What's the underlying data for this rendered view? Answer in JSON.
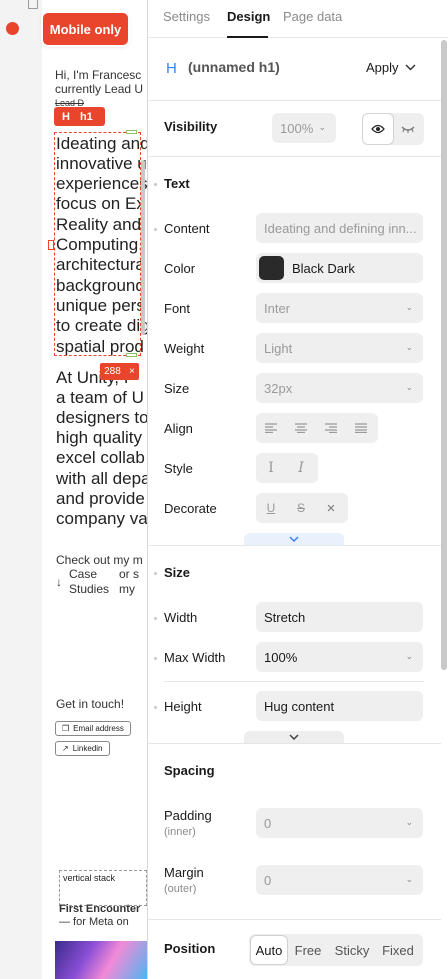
{
  "canvas": {
    "badge": "Mobile only",
    "intro_lines": [
      "Hi, I'm Francesc",
      "currently Lead U",
      "Lead D"
    ],
    "h1_tag_icon": "H",
    "h1_tag_label": "h1",
    "h1_lines": [
      "Ideating and",
      "innovative u",
      "experiences",
      "focus on Ex",
      "Reality and",
      "Computing.",
      "architectura",
      "background",
      "unique pers",
      "to create dig",
      "spatial prod"
    ],
    "size_badge_value": "288",
    "size_badge_close": "×",
    "para_lines": [
      "At Unity, I",
      "a team of U",
      "designers to",
      "high quality",
      "excel collab",
      "with all depa",
      "and provide",
      "company va"
    ],
    "check_out": "Check out my m",
    "case_studies_arrow": "↓",
    "case_studies_1": "Case",
    "case_studies_2": "Studies",
    "or_s": "or s",
    "my": "my",
    "get_in_touch": "Get in touch!",
    "email_btn": "Email address",
    "linkedin_btn": "Linkedin",
    "vstack_label": "vertical stack",
    "first_encounter": "First Encounter",
    "for_meta": "— for Meta on"
  },
  "panel": {
    "tabs": [
      {
        "label": "Settings"
      },
      {
        "label": "Design"
      },
      {
        "label": "Page data"
      }
    ],
    "element": {
      "icon": "H",
      "name": "(unnamed h1)",
      "apply": "Apply"
    },
    "visibility": {
      "label": "Visibility",
      "opacity": "100%"
    },
    "text_section": {
      "title": "Text",
      "content_label": "Content",
      "content_value": "Ideating and defining inn...",
      "color_label": "Color",
      "color_value": "Black Dark",
      "color_swatch": "#2a2a2a",
      "font_label": "Font",
      "font_value": "Inter",
      "weight_label": "Weight",
      "weight_value": "Light",
      "size_label": "Size",
      "size_value": "32px",
      "align_label": "Align",
      "style_label": "Style",
      "decorate_label": "Decorate"
    },
    "size_section": {
      "title": "Size",
      "width_label": "Width",
      "width_value": "Stretch",
      "maxwidth_label": "Max Width",
      "maxwidth_value": "100%",
      "height_label": "Height",
      "height_value": "Hug content"
    },
    "spacing_section": {
      "title": "Spacing",
      "padding_label": "Padding",
      "padding_sub": "(inner)",
      "padding_value": "0",
      "margin_label": "Margin",
      "margin_sub": "(outer)",
      "margin_value": "0"
    },
    "position_section": {
      "title": "Position",
      "options": [
        "Auto",
        "Free",
        "Sticky",
        "Fixed"
      ],
      "selected": "Auto"
    },
    "accent": "#e8452c",
    "blue": "#3b82f6"
  }
}
